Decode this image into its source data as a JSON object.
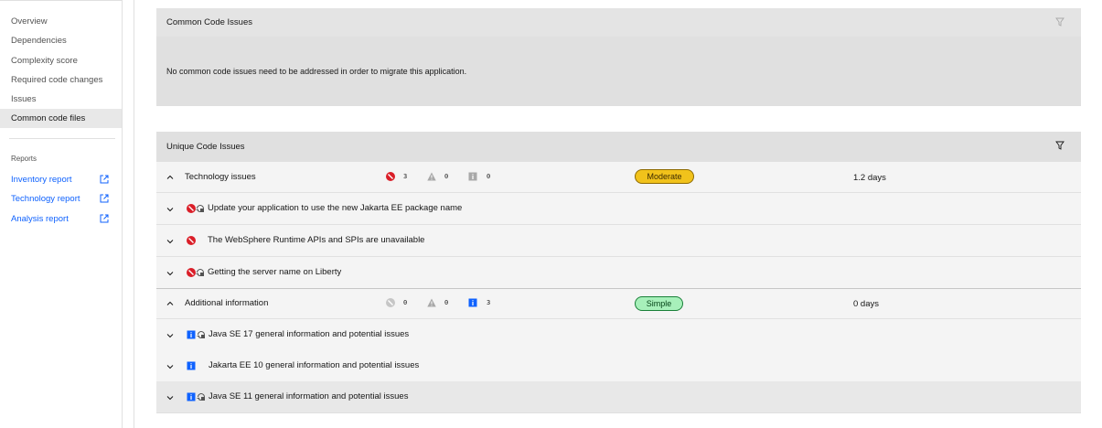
{
  "sidebar": {
    "nav_items": [
      {
        "label": "Overview",
        "active": false
      },
      {
        "label": "Dependencies",
        "active": false
      },
      {
        "label": "Complexity score",
        "active": false
      },
      {
        "label": "Required code changes",
        "active": false
      },
      {
        "label": "Issues",
        "active": false
      },
      {
        "label": "Common code files",
        "active": true
      }
    ],
    "reports_heading": "Reports",
    "reports": [
      {
        "label": "Inventory report",
        "icon": "launch-icon"
      },
      {
        "label": "Technology report",
        "icon": "launch-icon"
      },
      {
        "label": "Analysis report",
        "icon": "launch-icon"
      }
    ]
  },
  "common_issues": {
    "title": "Common Code Issues",
    "message": "No common code issues need to be addressed in order to migrate this application.",
    "filter_icon": "filter-icon"
  },
  "unique_issues": {
    "title": "Unique Code Issues",
    "filter_icon": "filter-icon",
    "groups": [
      {
        "label": "Technology issues",
        "counts": {
          "critical": "3",
          "warning": "0",
          "info": "0"
        },
        "complexity": "Moderate",
        "effort": "1.2 days",
        "items": [
          {
            "label": "Update your application to use the new Jakarta EE package name",
            "severity": "critical",
            "auto_fix": true
          },
          {
            "label": "The WebSphere Runtime APIs and SPIs are unavailable",
            "severity": "critical",
            "auto_fix": false
          },
          {
            "label": "Getting the server name on Liberty",
            "severity": "critical",
            "auto_fix": true
          }
        ]
      },
      {
        "label": "Additional information",
        "counts": {
          "critical": "0",
          "warning": "0",
          "info": "3"
        },
        "complexity": "Simple",
        "effort": "0 days",
        "items": [
          {
            "label": "Java SE 17 general information and potential issues",
            "severity": "info",
            "auto_fix": true
          },
          {
            "label": "Jakarta EE 10 general information and potential issues",
            "severity": "info",
            "auto_fix": false
          },
          {
            "label": "Java SE 11 general information and potential issues",
            "severity": "info",
            "auto_fix": true
          }
        ]
      }
    ]
  },
  "colors": {
    "critical": "#da1e28",
    "info": "#0f62fe",
    "moderate_tag": "#f1c21b",
    "simple_tag": "#a7f0ba",
    "link": "#0f62fe"
  }
}
